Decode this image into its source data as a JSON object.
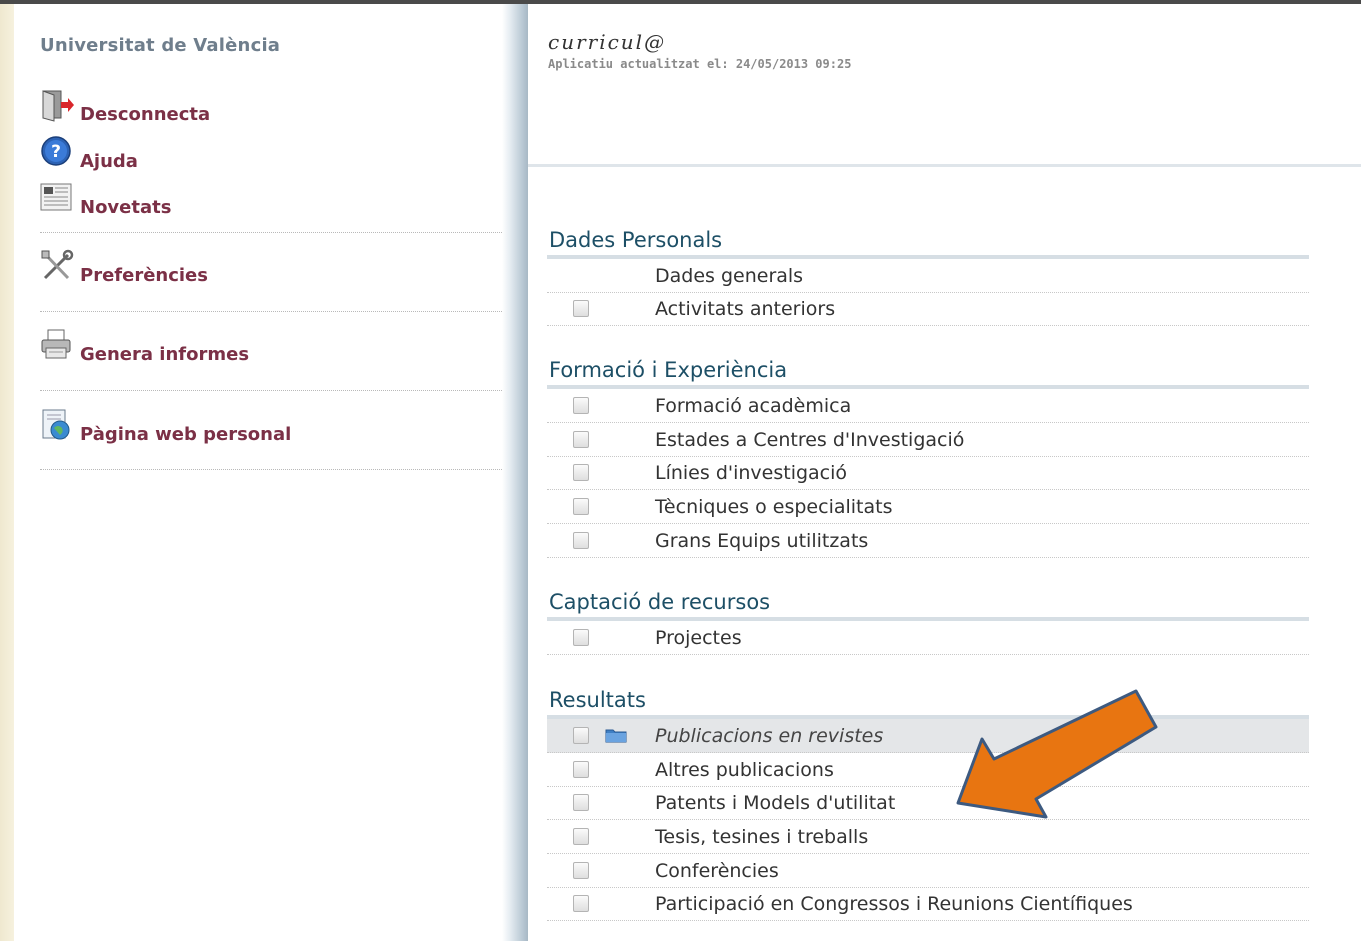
{
  "org_name": "Universitat de València",
  "nav": {
    "logout": "Desconnecta",
    "help": "Ajuda",
    "news": "Novetats",
    "prefs": "Preferències",
    "reports": "Genera informes",
    "web": "Pàgina web personal"
  },
  "app": {
    "title": "curricul@",
    "updated": "Aplicatiu actualitzat el: 24/05/2013 09:25"
  },
  "sections": [
    {
      "title": "Dades Personals",
      "items": [
        "Dades generals",
        "Activitats anteriors"
      ]
    },
    {
      "title": "Formació i Experiència",
      "items": [
        "Formació acadèmica",
        "Estades a Centres d'Investigació",
        "Línies d'investigació",
        "Tècniques o especialitats",
        "Grans Equips utilitzats"
      ]
    },
    {
      "title": "Captació de recursos",
      "items": [
        "Projectes"
      ]
    },
    {
      "title": "Resultats",
      "items": [
        "Publicacions en revistes",
        "Altres publicacions",
        "Patents i Models d'utilitat",
        "Tesis, tesines i treballs",
        "Conferències",
        "Participació en Congressos i Reunions Científiques"
      ]
    }
  ],
  "colors": {
    "nav_text": "#7b3046",
    "section_title": "#1d4f66",
    "arrow_fill": "#e87511",
    "arrow_border": "#3d5a80"
  },
  "icons": [
    "logout-icon",
    "help-icon",
    "news-icon",
    "preferences-icon",
    "printer-icon",
    "web-page-icon",
    "checkbox-icon",
    "folder-icon",
    "arrow-annotation"
  ]
}
